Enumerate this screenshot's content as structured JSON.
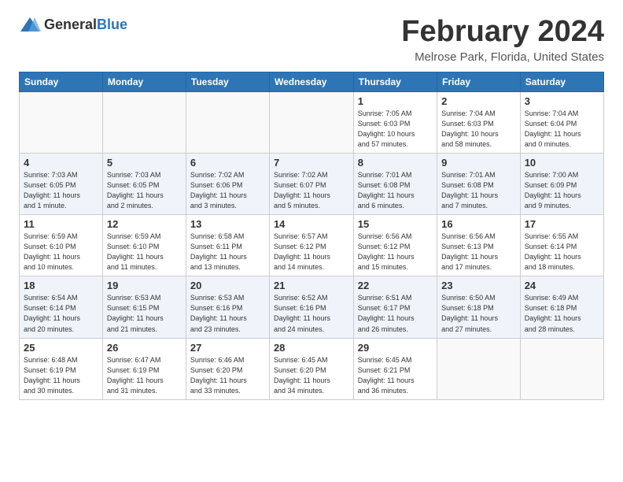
{
  "header": {
    "logo_general": "General",
    "logo_blue": "Blue",
    "month_title": "February 2024",
    "location": "Melrose Park, Florida, United States"
  },
  "weekdays": [
    "Sunday",
    "Monday",
    "Tuesday",
    "Wednesday",
    "Thursday",
    "Friday",
    "Saturday"
  ],
  "weeks": [
    [
      {
        "day": "",
        "info": ""
      },
      {
        "day": "",
        "info": ""
      },
      {
        "day": "",
        "info": ""
      },
      {
        "day": "",
        "info": ""
      },
      {
        "day": "1",
        "info": "Sunrise: 7:05 AM\nSunset: 6:03 PM\nDaylight: 10 hours\nand 57 minutes."
      },
      {
        "day": "2",
        "info": "Sunrise: 7:04 AM\nSunset: 6:03 PM\nDaylight: 10 hours\nand 58 minutes."
      },
      {
        "day": "3",
        "info": "Sunrise: 7:04 AM\nSunset: 6:04 PM\nDaylight: 11 hours\nand 0 minutes."
      }
    ],
    [
      {
        "day": "4",
        "info": "Sunrise: 7:03 AM\nSunset: 6:05 PM\nDaylight: 11 hours\nand 1 minute."
      },
      {
        "day": "5",
        "info": "Sunrise: 7:03 AM\nSunset: 6:05 PM\nDaylight: 11 hours\nand 2 minutes."
      },
      {
        "day": "6",
        "info": "Sunrise: 7:02 AM\nSunset: 6:06 PM\nDaylight: 11 hours\nand 3 minutes."
      },
      {
        "day": "7",
        "info": "Sunrise: 7:02 AM\nSunset: 6:07 PM\nDaylight: 11 hours\nand 5 minutes."
      },
      {
        "day": "8",
        "info": "Sunrise: 7:01 AM\nSunset: 6:08 PM\nDaylight: 11 hours\nand 6 minutes."
      },
      {
        "day": "9",
        "info": "Sunrise: 7:01 AM\nSunset: 6:08 PM\nDaylight: 11 hours\nand 7 minutes."
      },
      {
        "day": "10",
        "info": "Sunrise: 7:00 AM\nSunset: 6:09 PM\nDaylight: 11 hours\nand 9 minutes."
      }
    ],
    [
      {
        "day": "11",
        "info": "Sunrise: 6:59 AM\nSunset: 6:10 PM\nDaylight: 11 hours\nand 10 minutes."
      },
      {
        "day": "12",
        "info": "Sunrise: 6:59 AM\nSunset: 6:10 PM\nDaylight: 11 hours\nand 11 minutes."
      },
      {
        "day": "13",
        "info": "Sunrise: 6:58 AM\nSunset: 6:11 PM\nDaylight: 11 hours\nand 13 minutes."
      },
      {
        "day": "14",
        "info": "Sunrise: 6:57 AM\nSunset: 6:12 PM\nDaylight: 11 hours\nand 14 minutes."
      },
      {
        "day": "15",
        "info": "Sunrise: 6:56 AM\nSunset: 6:12 PM\nDaylight: 11 hours\nand 15 minutes."
      },
      {
        "day": "16",
        "info": "Sunrise: 6:56 AM\nSunset: 6:13 PM\nDaylight: 11 hours\nand 17 minutes."
      },
      {
        "day": "17",
        "info": "Sunrise: 6:55 AM\nSunset: 6:14 PM\nDaylight: 11 hours\nand 18 minutes."
      }
    ],
    [
      {
        "day": "18",
        "info": "Sunrise: 6:54 AM\nSunset: 6:14 PM\nDaylight: 11 hours\nand 20 minutes."
      },
      {
        "day": "19",
        "info": "Sunrise: 6:53 AM\nSunset: 6:15 PM\nDaylight: 11 hours\nand 21 minutes."
      },
      {
        "day": "20",
        "info": "Sunrise: 6:53 AM\nSunset: 6:16 PM\nDaylight: 11 hours\nand 23 minutes."
      },
      {
        "day": "21",
        "info": "Sunrise: 6:52 AM\nSunset: 6:16 PM\nDaylight: 11 hours\nand 24 minutes."
      },
      {
        "day": "22",
        "info": "Sunrise: 6:51 AM\nSunset: 6:17 PM\nDaylight: 11 hours\nand 26 minutes."
      },
      {
        "day": "23",
        "info": "Sunrise: 6:50 AM\nSunset: 6:18 PM\nDaylight: 11 hours\nand 27 minutes."
      },
      {
        "day": "24",
        "info": "Sunrise: 6:49 AM\nSunset: 6:18 PM\nDaylight: 11 hours\nand 28 minutes."
      }
    ],
    [
      {
        "day": "25",
        "info": "Sunrise: 6:48 AM\nSunset: 6:19 PM\nDaylight: 11 hours\nand 30 minutes."
      },
      {
        "day": "26",
        "info": "Sunrise: 6:47 AM\nSunset: 6:19 PM\nDaylight: 11 hours\nand 31 minutes."
      },
      {
        "day": "27",
        "info": "Sunrise: 6:46 AM\nSunset: 6:20 PM\nDaylight: 11 hours\nand 33 minutes."
      },
      {
        "day": "28",
        "info": "Sunrise: 6:45 AM\nSunset: 6:20 PM\nDaylight: 11 hours\nand 34 minutes."
      },
      {
        "day": "29",
        "info": "Sunrise: 6:45 AM\nSunset: 6:21 PM\nDaylight: 11 hours\nand 36 minutes."
      },
      {
        "day": "",
        "info": ""
      },
      {
        "day": "",
        "info": ""
      }
    ]
  ]
}
